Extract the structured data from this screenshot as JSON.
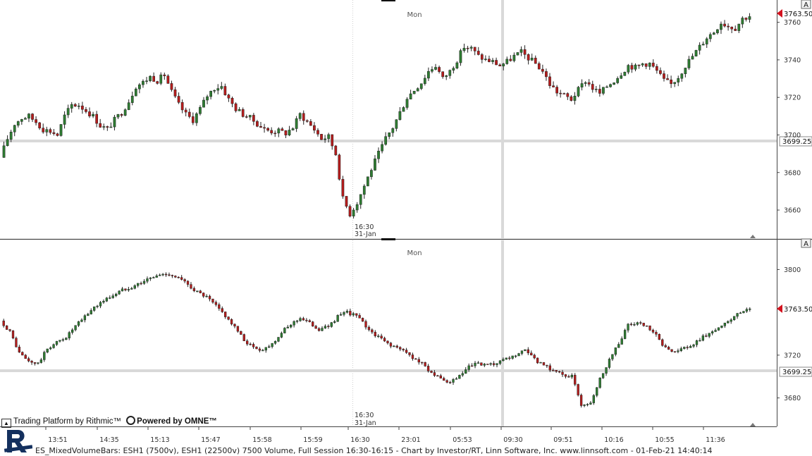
{
  "chart_data": [
    {
      "type": "candlestick",
      "title": "",
      "symbol_label": "ES_MixedVolumeBars: ESH1 (7500v)",
      "ylim": [
        3648,
        3770
      ],
      "yticks": [
        3660,
        3680,
        3700,
        3720,
        3740,
        3760
      ],
      "current_price": "3763.50",
      "crosshair_price": "3699.25",
      "session_label": {
        "time": "16:30",
        "date": "31-Jan"
      },
      "day_label": "Mon",
      "axis_button": "A",
      "close_path": [
        3688,
        3698,
        3706,
        3709,
        3710,
        3707,
        3703,
        3702,
        3700,
        3710,
        3716,
        3716,
        3713,
        3710,
        3705,
        3703,
        3708,
        3712,
        3718,
        3726,
        3728,
        3731,
        3729,
        3732,
        3723,
        3716,
        3711,
        3708,
        3714,
        3721,
        3725,
        3726,
        3719,
        3714,
        3711,
        3709,
        3706,
        3703,
        3702,
        3702,
        3701,
        3704,
        3711,
        3707,
        3703,
        3698,
        3699,
        3690,
        3666,
        3658,
        3664,
        3673,
        3682,
        3690,
        3698,
        3704,
        3712,
        3720,
        3724,
        3728,
        3734,
        3737,
        3730,
        3734,
        3740,
        3747,
        3746,
        3742,
        3740,
        3739,
        3737,
        3739,
        3742,
        3744,
        3741,
        3738,
        3734,
        3727,
        3723,
        3721,
        3719,
        3724,
        3729,
        3725,
        3722,
        3726,
        3729,
        3733,
        3737,
        3736,
        3738,
        3738,
        3734,
        3729,
        3727,
        3731,
        3737,
        3742,
        3747,
        3752,
        3755,
        3760,
        3758,
        3757,
        3762,
        3763.5
      ]
    },
    {
      "type": "candlestick",
      "title": "",
      "symbol_label": "ESH1 (22500v) 7500 Volume",
      "ylim": [
        3658,
        3824
      ],
      "yticks": [
        3680,
        3720,
        3800
      ],
      "current_price": "3763.50",
      "crosshair_price": "3699.25",
      "session_label": {
        "time": "16:30",
        "date": "31-Jan"
      },
      "day_label": "Mon",
      "axis_button": "A",
      "close_path": [
        3752,
        3742,
        3722,
        3714,
        3712,
        3726,
        3732,
        3737,
        3747,
        3756,
        3765,
        3771,
        3776,
        3781,
        3784,
        3788,
        3792,
        3795,
        3796,
        3792,
        3786,
        3779,
        3774,
        3766,
        3757,
        3746,
        3734,
        3727,
        3725,
        3731,
        3741,
        3749,
        3755,
        3750,
        3744,
        3747,
        3756,
        3760,
        3757,
        3747,
        3739,
        3733,
        3728,
        3724,
        3718,
        3712,
        3704,
        3697,
        3694,
        3700,
        3709,
        3712,
        3710,
        3712,
        3716,
        3720,
        3724,
        3716,
        3710,
        3706,
        3702,
        3700,
        3674,
        3676,
        3698,
        3716,
        3731,
        3748,
        3750,
        3746,
        3738,
        3726,
        3724,
        3726,
        3730,
        3737,
        3742,
        3747,
        3753,
        3760,
        3763.5
      ]
    }
  ],
  "x_axis_labels": [
    "13:51",
    "14:35",
    "15:13",
    "15:47",
    "15:58",
    "15:59",
    "16:30",
    "23:01",
    "05:53",
    "09:30",
    "09:51",
    "10:16",
    "10:55",
    "11:36"
  ],
  "colors": {
    "up": "#2e7d32",
    "down": "#b71c1c",
    "crosshair": "#d9d9d9",
    "price_tag": "#d3121e",
    "text": "#222222"
  },
  "branding": {
    "rithmic": "Trading Platform by Rithmic™",
    "omne": "Powered by OMNE™"
  },
  "footer": "ES_MixedVolumeBars: ESH1 (7500v), ESH1 (22500v) 7500 Volume, Full Session 16:30-16:15 - Chart by Investor/RT, Linn Software, Inc. www.linnsoft.com - 01-Feb-21 14:40:14"
}
